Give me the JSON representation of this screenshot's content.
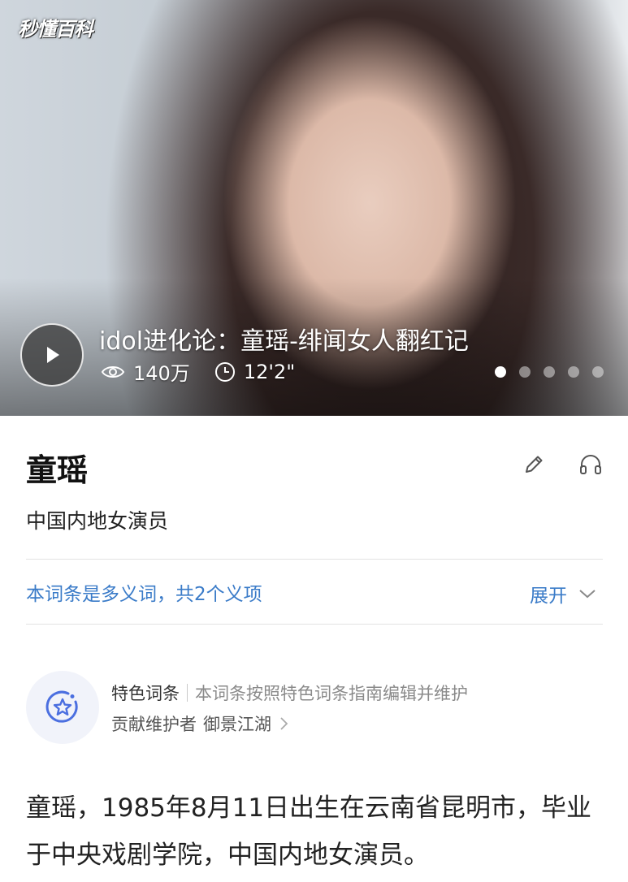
{
  "hero": {
    "brand": "秒懂百科",
    "video_title": "idol进化论：童瑶-绯闻女人翻红记",
    "views": "140万",
    "duration": "12'2\"",
    "slide_count": 5,
    "active_slide": 1,
    "icons": [
      "play-icon",
      "eye-icon",
      "clock-icon"
    ]
  },
  "entry": {
    "title": "童瑶",
    "subtitle": "中国内地女演员",
    "icons": [
      "pencil-icon",
      "headphones-icon"
    ]
  },
  "polysemy": {
    "text": "本词条是多义词，共2个义项",
    "expand_label": "展开"
  },
  "feature": {
    "label": "特色词条",
    "description": "本词条按照特色词条指南编辑并维护",
    "contributor_label": "贡献维护者",
    "maintainer": "御景江湖"
  },
  "intro": {
    "text": "童瑶，1985年8月11日出生在云南省昆明市，毕业于中央戏剧学院，中国内地女演员。"
  },
  "colors": {
    "link_blue": "#3a7bc8",
    "badge_blue": "#4b6fe0",
    "divider": "#e3e3e3"
  }
}
